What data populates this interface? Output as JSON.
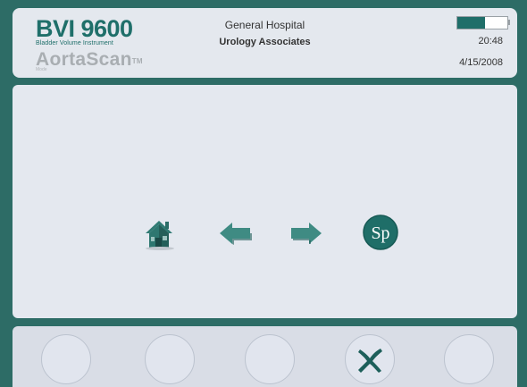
{
  "header": {
    "product_name": "BVI 9600",
    "product_subtitle": "Bladder Volume Instrument",
    "mode_name": "AortaScan",
    "mode_trademark": "TM",
    "mode_label": "Mode",
    "facility_name": "General Hospital",
    "department_name": "Urology Associates",
    "battery_level_percent": 55,
    "time": "20:48",
    "date": "4/15/2008"
  },
  "main": {
    "icons": [
      "home-icon",
      "arrow-left-icon",
      "arrow-right-icon",
      "sp-icon"
    ],
    "sp_label": "Sp"
  },
  "footer": {
    "softkeys": [
      "blank",
      "blank",
      "blank",
      "cancel-x-icon",
      "blank"
    ]
  },
  "colors": {
    "frame": "#2d6c66",
    "accent": "#1f6f6a",
    "panel": "#e4e8ee"
  }
}
